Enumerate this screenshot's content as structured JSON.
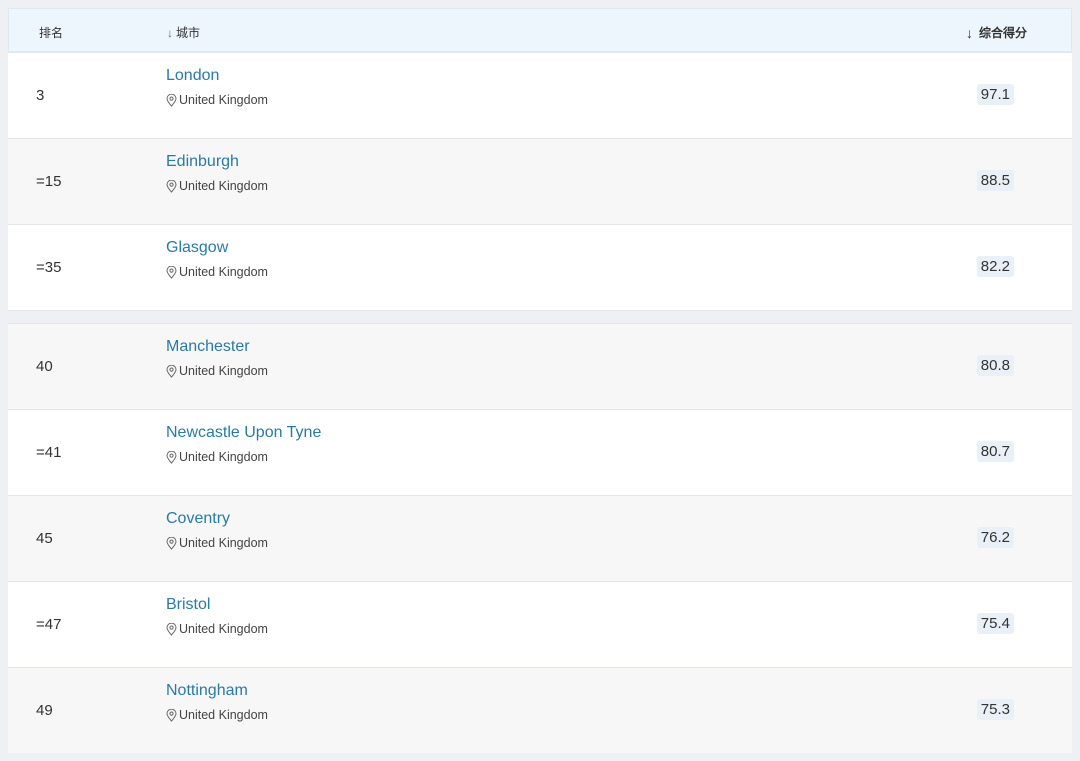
{
  "header": {
    "rank_label": "排名",
    "city_label": "城市",
    "score_label": "综合得分"
  },
  "rows_top": [
    {
      "rank": "3",
      "city": "London",
      "country": "United Kingdom",
      "score": "97.1"
    },
    {
      "rank": "=15",
      "city": "Edinburgh",
      "country": "United Kingdom",
      "score": "88.5"
    },
    {
      "rank": "=35",
      "city": "Glasgow",
      "country": "United Kingdom",
      "score": "82.2"
    }
  ],
  "rows_bottom": [
    {
      "rank": "40",
      "city": "Manchester",
      "country": "United Kingdom",
      "score": "80.8"
    },
    {
      "rank": "=41",
      "city": "Newcastle Upon Tyne",
      "country": "United Kingdom",
      "score": "80.7"
    },
    {
      "rank": "45",
      "city": "Coventry",
      "country": "United Kingdom",
      "score": "76.2"
    },
    {
      "rank": "=47",
      "city": "Bristol",
      "country": "United Kingdom",
      "score": "75.4"
    },
    {
      "rank": "49",
      "city": "Nottingham",
      "country": "United Kingdom",
      "score": "75.3"
    }
  ],
  "colors": {
    "city_link": "#2a7aa6",
    "header_bg": "#eef6fd",
    "score_badge_bg": "#eaf0f8"
  },
  "icons": {
    "sort": "arrow-down-icon",
    "location": "map-pin-icon"
  }
}
